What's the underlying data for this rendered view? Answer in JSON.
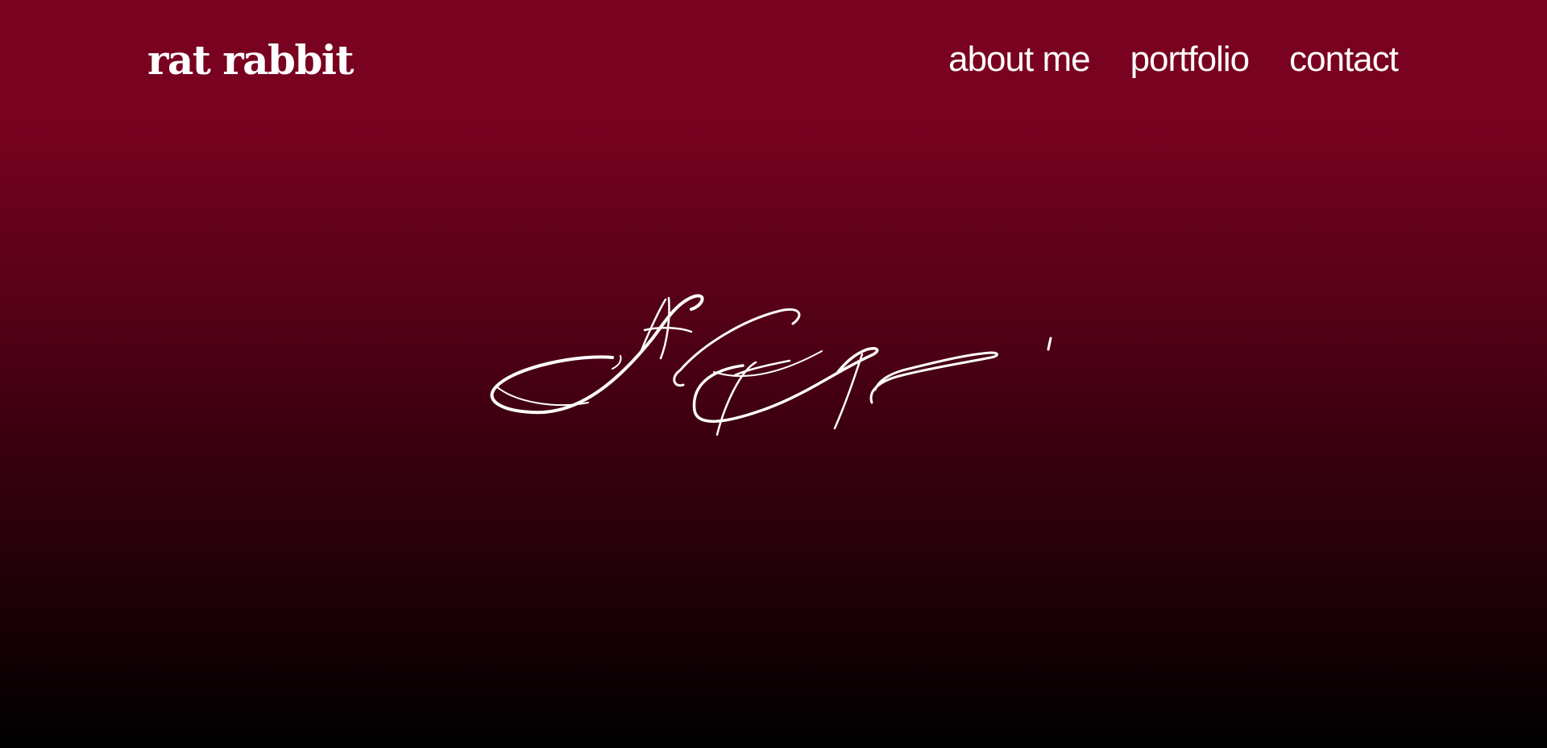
{
  "header": {
    "brand": "rat rabbit",
    "nav": [
      {
        "label": "about me"
      },
      {
        "label": "portfolio"
      },
      {
        "label": "contact"
      }
    ]
  },
  "hero": {
    "signature_icon": "handwritten-signature",
    "signature_color": "#ffffff"
  },
  "theme": {
    "background_top": "#7a0220",
    "background_bottom": "#000000",
    "text_color": "#ffffff"
  }
}
